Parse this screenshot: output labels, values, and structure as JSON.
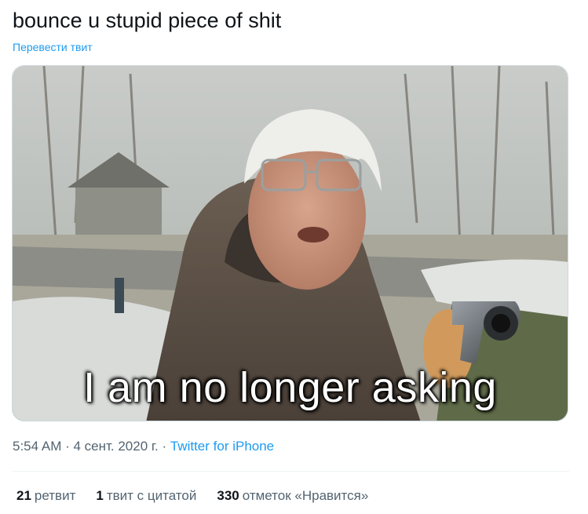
{
  "tweet": {
    "text": "bounce u stupid piece of shit",
    "translate_label": "Перевести твит",
    "media": {
      "caption": "I am no longer asking"
    },
    "meta": {
      "time": "5:54 AM",
      "separator1": " · ",
      "date": "4 сент. 2020 г.",
      "separator2": " · ",
      "source": "Twitter for iPhone"
    },
    "stats": {
      "retweets_count": "21",
      "retweets_label": "ретвит",
      "quotes_count": "1",
      "quotes_label": "твит с цитатой",
      "likes_count": "330",
      "likes_label": "отметок «Нравится»"
    }
  },
  "colors": {
    "link": "#1d9bf0",
    "secondary_text": "#536471",
    "primary_text": "#0f1419"
  }
}
